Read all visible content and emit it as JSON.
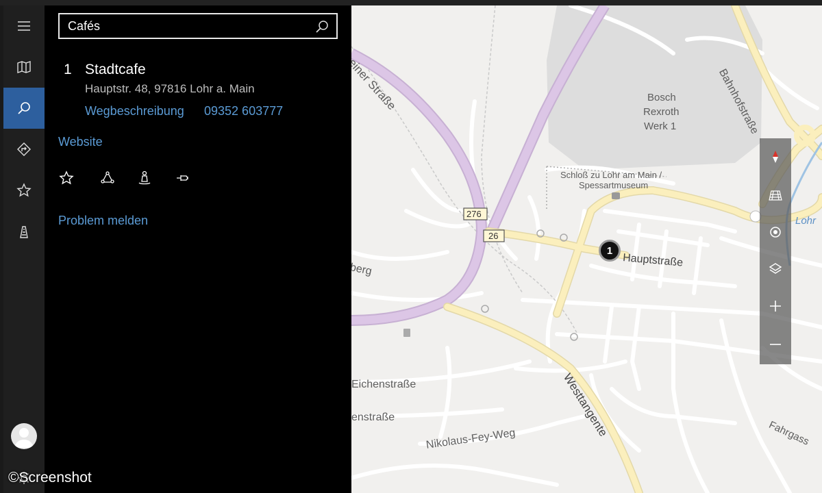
{
  "search": {
    "value": "Cafés"
  },
  "result": {
    "number": "1",
    "name": "Stadtcafe",
    "address": "Hauptstr. 48, 97816 Lohr a. Main",
    "directions_label": "Wegbeschreibung",
    "phone": "09352 603777",
    "website_label": "Website",
    "report_label": "Problem melden"
  },
  "rail": {
    "items": [
      {
        "icon": "menu-icon"
      },
      {
        "icon": "map-icon"
      },
      {
        "icon": "search-icon",
        "active": true
      },
      {
        "icon": "directions-icon"
      },
      {
        "icon": "favorites-icon"
      },
      {
        "icon": "traffic-icon"
      }
    ]
  },
  "actions": [
    "favorite-icon",
    "share-icon",
    "streetside-icon",
    "pin-to-start-icon"
  ],
  "map": {
    "labels": {
      "bahnhof": "Bahnhofstraße",
      "bosch1": "Bosch",
      "bosch2": "Rexroth",
      "bosch3": "Werk 1",
      "schloss1": "Schloß zu Lohr am Main /",
      "schloss2": "Spessartmuseum",
      "haupt": "Hauptstraße",
      "einer": "einer Straße",
      "berg": "berg",
      "eichen": "Eichenstraße",
      "enstr": "enstraße",
      "nikolaus": "Nikolaus-Fey-Weg",
      "west": "Westtangente",
      "fahr": "Fahrgass",
      "lohr": "Lohr",
      "shield276": "276",
      "shield26": "26"
    },
    "pin_number": "1"
  },
  "watermark": "©Screenshot",
  "colors": {
    "accent": "#2d5f9e",
    "link": "#5b9bd5",
    "panel": "#000000",
    "map_bg": "#f1f0ee",
    "road_major": "#fbefbd",
    "road_highway": "#dcc6e6"
  }
}
